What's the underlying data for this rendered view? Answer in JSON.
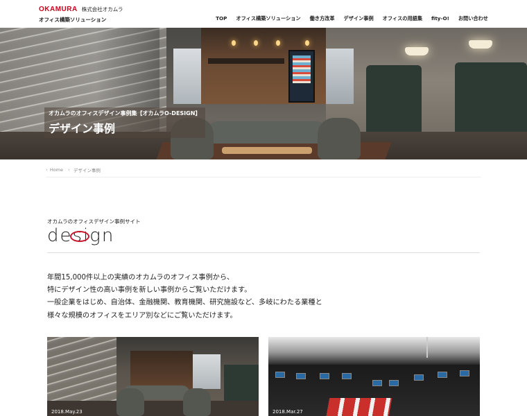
{
  "header": {
    "brand": "OKAMURA",
    "corporate_name": "株式会社オカムラ",
    "site_title": "オフィス構築ソリューション",
    "nav": [
      "TOP",
      "オフィス構築ソリューション",
      "働き方改革",
      "デザイン事例",
      "オフィスの用語集",
      "fity-O!",
      "お問い合わせ"
    ]
  },
  "hero": {
    "subtitle": "オカムラのオフィスデザイン事例集【オカムラO-DESIGN】",
    "title": "デザイン事例"
  },
  "breadcrumb": {
    "home": "Home",
    "current": "デザイン事例"
  },
  "section": {
    "site_label": "オカムラのオフィスデザイン事例サイト",
    "logo_text": "design"
  },
  "intro": [
    "年間15,000件以上の実績のオカムラのオフィス事例から、",
    "特にデザイン性の高い事例を新しい事例からご覧いただけます。",
    "一般企業をはじめ、自治体、金融機関、教育機関、研究施設など、多岐にわたる業種と",
    "様々な規模のオフィスをエリア別などにご覧いただけます。"
  ],
  "cards": [
    {
      "date": "2018.May.23"
    },
    {
      "date": "2018.Mar.27"
    }
  ],
  "colors": {
    "brand_red": "#d0021b",
    "logo_ring_red": "#c8162c"
  }
}
